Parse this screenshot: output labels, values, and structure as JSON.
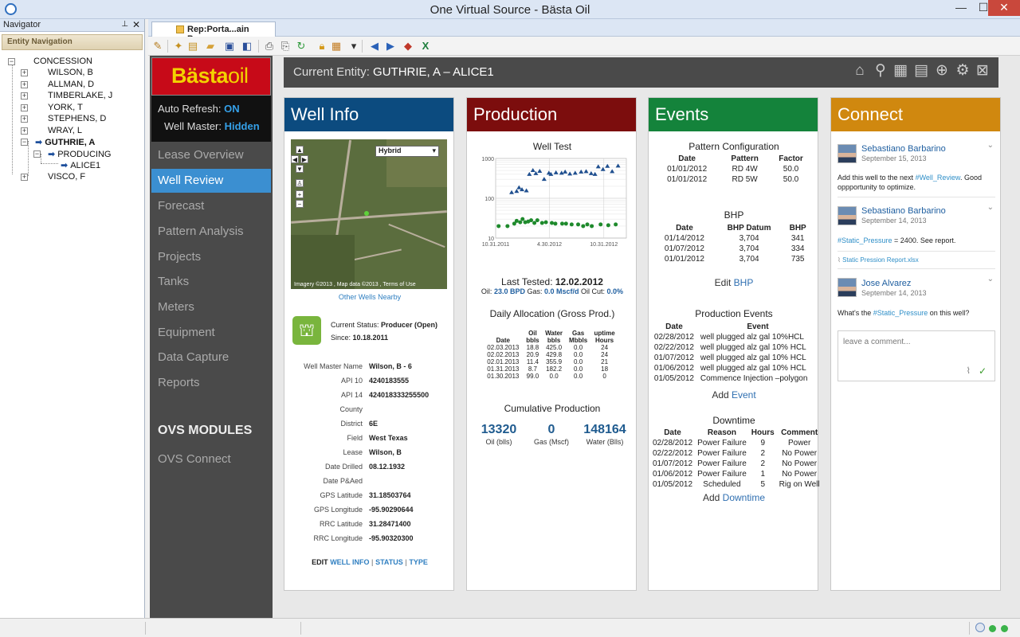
{
  "window": {
    "title": "One Virtual Source - Bästa Oil"
  },
  "navigator": {
    "title": "Navigator",
    "section": "Entity Navigation",
    "root": "CONCESSION",
    "nodes": [
      "WILSON, B",
      "ALLMAN, D",
      "TIMBERLAKE, J",
      "YORK, T",
      "STEPHENS, D",
      "WRAY, L",
      "GUTHRIE, A",
      "PRODUCING",
      "ALICE1",
      "VISCO, F"
    ]
  },
  "doc_tab": {
    "label": "Rep:Porta...ain Page"
  },
  "logo": {
    "part1": "Bästa",
    "part2": "oil"
  },
  "settings": {
    "auto_refresh_label": "Auto Refresh: ",
    "auto_refresh_value": "ON",
    "well_master_label": "Well Master: ",
    "well_master_value": "Hidden"
  },
  "menu": {
    "items": [
      "Lease Overview",
      "Well Review",
      "Forecast",
      "Pattern Analysis",
      "Projects",
      "Tanks",
      "Meters",
      "Equipment",
      "Data Capture",
      "Reports"
    ],
    "modules_heading": "OVS MODULES",
    "connect": "OVS Connect"
  },
  "entity": {
    "label": "Current Entity: ",
    "value": "GUTHRIE, A – ALICE1"
  },
  "well_info": {
    "title": "Well Info",
    "map_type": "Hybrid",
    "map_attribution": "Imagery ©2013 , Map data ©2013 , Terms of Use",
    "nearby": "Other Wells Nearby",
    "status_label": "Current Status: ",
    "status_value": "Producer (Open)",
    "since_label": "Since: ",
    "since_value": "10.18.2011",
    "fields": [
      {
        "k": "Well Master Name",
        "v": "Wilson, B - 6"
      },
      {
        "k": "API 10",
        "v": "4240183555"
      },
      {
        "k": "API 14",
        "v": "424018333255500"
      },
      {
        "k": "County",
        "v": ""
      },
      {
        "k": "District",
        "v": "6E"
      },
      {
        "k": "Field",
        "v": "West Texas"
      },
      {
        "k": "Lease",
        "v": "Wilson, B"
      },
      {
        "k": "Date Drilled",
        "v": "08.12.1932"
      },
      {
        "k": "Date P&Aed",
        "v": ""
      },
      {
        "k": "GPS Latitude",
        "v": "31.18503764"
      },
      {
        "k": "GPS Longitude",
        "v": "-95.90290644"
      },
      {
        "k": "RRC Latitude",
        "v": "31.28471400"
      },
      {
        "k": "RRC Longitude",
        "v": "-95.90320300"
      }
    ],
    "edit": "EDIT",
    "edit_well_info": "WELL INFO",
    "edit_status": "STATUS",
    "edit_type": "TYPE"
  },
  "production": {
    "title": "Production",
    "chart_title": "Well Test",
    "last_tested_label": "Last Tested: ",
    "last_tested_value": "12.02.2012",
    "oil_label": "Oil: ",
    "oil_value": "23.0 BPD",
    "gas_label": "Gas: ",
    "gas_value": "0.0 Mscf/d",
    "oilcut_label": "Oil Cut: ",
    "oilcut_value": "0.0%",
    "alloc_title": "Daily Allocation (Gross Prod.)",
    "alloc_headers": [
      [
        "Date",
        ""
      ],
      [
        "Oil",
        "bbls"
      ],
      [
        "Water",
        "bbls"
      ],
      [
        "Gas",
        "Mbbls"
      ],
      [
        "uptime",
        "Hours"
      ]
    ],
    "alloc_rows": [
      [
        "02.03.2013",
        "18.8",
        "425.0",
        "0.0",
        "24"
      ],
      [
        "02.02.2013",
        "20.9",
        "429.8",
        "0.0",
        "24"
      ],
      [
        "02.01.2013",
        "11.4",
        "355.9",
        "0.0",
        "21"
      ],
      [
        "01.31.2013",
        "8.7",
        "182.2",
        "0.0",
        "18"
      ],
      [
        "01.30.2013",
        "99.0",
        "0.0",
        "0.0",
        "0"
      ]
    ],
    "cum_title": "Cumulative Production",
    "cum_oil": "13320",
    "cum_oil_label": "Oil (blls)",
    "cum_gas": "0",
    "cum_gas_label": "Gas (Mscf)",
    "cum_water": "148164",
    "cum_water_label": "Water (Blls)"
  },
  "chart_data": {
    "type": "scatter",
    "title": "Well Test",
    "y_scale": "log",
    "ylim": [
      10,
      1000
    ],
    "y_ticks": [
      "1000",
      "100",
      "10"
    ],
    "x_ticks": [
      "10.31.2011",
      "4.30.2012",
      "10.31.2012"
    ],
    "xlim": [
      "2011-10-31",
      "2013-01-15"
    ],
    "grid": true,
    "series": [
      {
        "marker": "triangle",
        "color": "#1f4f8f",
        "points": [
          [
            "2011-12-24",
            140
          ],
          [
            "2012-01-10",
            150
          ],
          [
            "2012-01-18",
            185
          ],
          [
            "2012-01-28",
            165
          ],
          [
            "2012-02-12",
            155
          ],
          [
            "2012-02-22",
            400
          ],
          [
            "2012-03-05",
            500
          ],
          [
            "2012-03-15",
            420
          ],
          [
            "2012-03-28",
            480
          ],
          [
            "2012-04-12",
            300
          ],
          [
            "2012-04-28",
            430
          ],
          [
            "2012-05-05",
            400
          ],
          [
            "2012-05-22",
            440
          ],
          [
            "2012-06-10",
            430
          ],
          [
            "2012-06-22",
            460
          ],
          [
            "2012-07-08",
            410
          ],
          [
            "2012-07-26",
            430
          ],
          [
            "2012-08-15",
            460
          ],
          [
            "2012-09-01",
            470
          ],
          [
            "2012-09-18",
            420
          ],
          [
            "2012-10-01",
            400
          ],
          [
            "2012-10-12",
            620
          ],
          [
            "2012-10-28",
            530
          ],
          [
            "2012-11-12",
            640
          ],
          [
            "2012-11-28",
            470
          ],
          [
            "2012-12-18",
            650
          ]
        ]
      },
      {
        "marker": "circle",
        "color": "#1e8a2c",
        "points": [
          [
            "2011-11-10",
            20
          ],
          [
            "2011-12-10",
            20
          ],
          [
            "2012-01-02",
            23
          ],
          [
            "2012-01-10",
            27
          ],
          [
            "2012-01-22",
            25
          ],
          [
            "2012-01-30",
            30
          ],
          [
            "2012-02-08",
            25
          ],
          [
            "2012-02-18",
            26
          ],
          [
            "2012-02-28",
            28
          ],
          [
            "2012-03-10",
            24
          ],
          [
            "2012-03-20",
            28
          ],
          [
            "2012-04-05",
            24
          ],
          [
            "2012-04-18",
            25
          ],
          [
            "2012-05-08",
            24
          ],
          [
            "2012-05-20",
            23
          ],
          [
            "2012-06-12",
            23
          ],
          [
            "2012-06-25",
            23
          ],
          [
            "2012-07-14",
            22
          ],
          [
            "2012-08-05",
            22
          ],
          [
            "2012-08-22",
            20
          ],
          [
            "2012-09-05",
            22
          ],
          [
            "2012-09-20",
            20
          ],
          [
            "2012-10-20",
            22
          ],
          [
            "2012-11-15",
            21
          ],
          [
            "2012-12-10",
            22
          ]
        ]
      }
    ]
  },
  "events": {
    "title": "Events",
    "pattern_title": "Pattern Configuration",
    "pattern_headers": [
      "Date",
      "Pattern",
      "Factor"
    ],
    "pattern_rows": [
      [
        "01/01/2012",
        "RD 4W",
        "50.0"
      ],
      [
        "01/01/2012",
        "RD 5W",
        "50.0"
      ]
    ],
    "bhp_title": "BHP",
    "bhp_headers": [
      "Date",
      "BHP Datum",
      "BHP"
    ],
    "bhp_rows": [
      [
        "01/14/2012",
        "3,704",
        "341"
      ],
      [
        "01/07/2012",
        "3,704",
        "334"
      ],
      [
        "01/01/2012",
        "3,704",
        "735"
      ]
    ],
    "edit_bhp_prefix": "Edit ",
    "edit_bhp": "BHP",
    "prod_events_title": "Production Events",
    "prod_events_headers": [
      "Date",
      "Event"
    ],
    "prod_events_rows": [
      [
        "02/28/2012",
        "well plugged alz gal 10%HCL"
      ],
      [
        "02/22/2012",
        "well plugged alz gal 10% HCL"
      ],
      [
        "01/07/2012",
        "well plugged alz gal 10% HCL"
      ],
      [
        "01/06/2012",
        "well plugged alz gal 10% HCL"
      ],
      [
        "01/05/2012",
        "Commence Injection –polygon"
      ]
    ],
    "add_event_prefix": "Add ",
    "add_event": "Event",
    "downtime_title": "Downtime",
    "downtime_headers": [
      "Date",
      "Reason",
      "Hours",
      "Comment"
    ],
    "downtime_rows": [
      [
        "02/28/2012",
        "Power Failure",
        "9",
        "Power"
      ],
      [
        "02/22/2012",
        "Power Failure",
        "2",
        "No Power"
      ],
      [
        "01/07/2012",
        "Power Failure",
        "2",
        "No Power"
      ],
      [
        "01/06/2012",
        "Power Failure",
        "1",
        "No Power"
      ],
      [
        "01/05/2012",
        "Scheduled",
        "5",
        "Rig on Well"
      ]
    ],
    "add_downtime_prefix": "Add ",
    "add_downtime": "Downtime"
  },
  "connect": {
    "title": "Connect",
    "posts": [
      {
        "author": "Sebastiano Barbarino",
        "date": "September 15, 2013",
        "pre": "Add this well to the next ",
        "tag": "#Well_Review",
        "post": ". Good oppportunity to optimize."
      },
      {
        "author": "Sebastiano Barbarino",
        "date": "September 14, 2013",
        "pre": "",
        "tag": "#Static_Pressure",
        "post": " = 2400. See report.",
        "attachment": "Static Pression Report.xlsx"
      },
      {
        "author": "Jose Alvarez",
        "date": "September 14, 2013",
        "pre": "What's the ",
        "tag": "#Static_Pressure",
        "post": " on this well?"
      }
    ],
    "comment_placeholder": "leave a comment..."
  }
}
